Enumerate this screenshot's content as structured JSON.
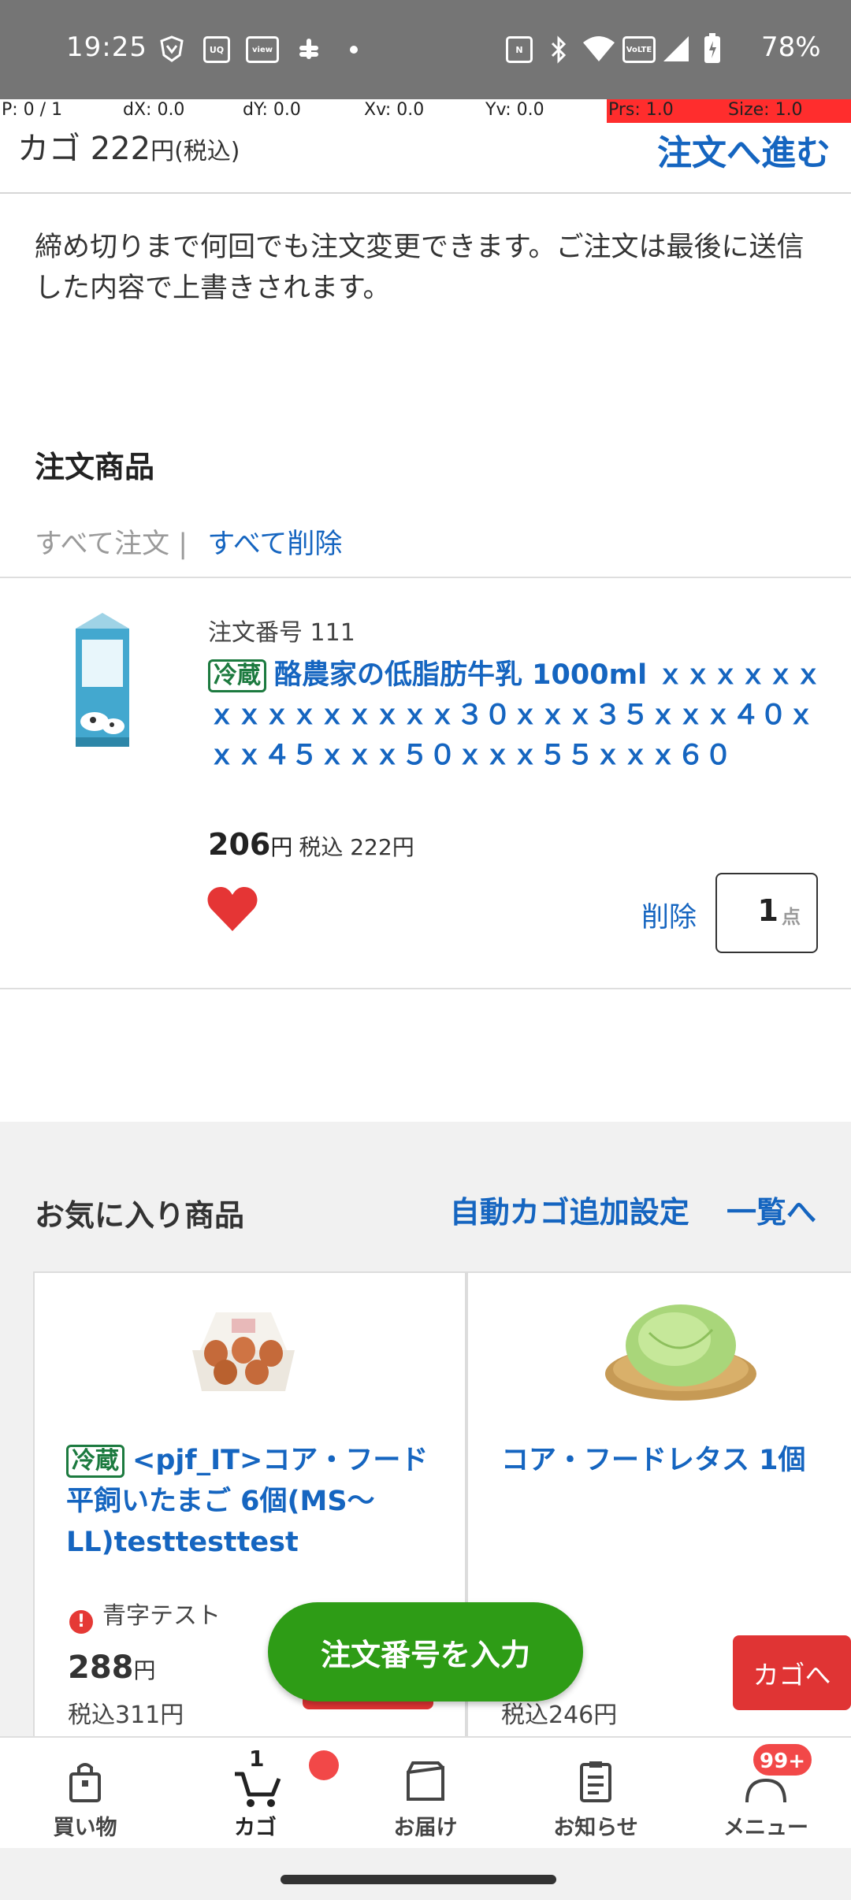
{
  "status_bar": {
    "time": "19:25",
    "battery": "78%",
    "notification_icons": [
      "shield-icon",
      "uniqlo-icon",
      "view-icon",
      "slack-icon"
    ],
    "system_icons": [
      "nfc-icon",
      "bluetooth-icon",
      "wifi-icon",
      "volte-icon",
      "signal-icon",
      "battery-icon"
    ]
  },
  "debug": {
    "p": "P: 0 / 1",
    "dx": "dX: 0.0",
    "dy": "dY: 0.0",
    "xv": "Xv: 0.0",
    "yv": "Yv: 0.0",
    "prs": "Prs: 1.0",
    "size": "Size: 1.0"
  },
  "cart_header": {
    "label": "カゴ",
    "amount": "222",
    "unit": "円",
    "tax_note": "(税込)",
    "checkout": "注文へ進む"
  },
  "notice": "締め切りまで何回でも注文変更できます。ご注文は最後に送信した内容で上書きされます。",
  "order_section": {
    "title": "注文商品",
    "order_all": "すべて注文",
    "separator": "|",
    "delete_all": "すべて削除"
  },
  "order_item": {
    "order_number": "注文番号 111",
    "tag": "冷蔵",
    "name": "酪農家の低脂肪牛乳 1000ml ｘｘｘｘｘｘｘｘｘｘｘｘｘｘｘ３０ｘｘｘ３５ｘｘｘ４０ｘｘｘ４５ｘｘｘ５０ｘｘｘ５５ｘｘｘ６０",
    "price": "206",
    "price_unit": "円",
    "tax_price": "税込 222円",
    "delete": "削除",
    "quantity": "1",
    "quantity_unit": "点"
  },
  "favorites": {
    "title": "お気に入り商品",
    "auto_cart": "自動カゴ追加設定",
    "view_all": "一覧へ",
    "items": [
      {
        "tag": "冷蔵",
        "name": "<pjf_IT>コア・フード平飼いたまご 6個(MS〜LL)testtesttest",
        "warning": "青字テスト",
        "price": "288",
        "price_unit": "円",
        "tax_price": "税込311円"
      },
      {
        "name": "コア・フードレタス 1個",
        "tax_price": "税込246円",
        "cart_button": "カゴへ"
      }
    ]
  },
  "fab": "注文番号を入力",
  "bottom_nav": {
    "items": [
      {
        "label": "買い物",
        "icon": "shopping-bag-icon"
      },
      {
        "label": "カゴ",
        "icon": "cart-icon",
        "count": "1"
      },
      {
        "label": "お届け",
        "icon": "delivery-box-icon"
      },
      {
        "label": "お知らせ",
        "icon": "clipboard-icon"
      },
      {
        "label": "メニュー",
        "icon": "person-icon",
        "badge": "99+"
      }
    ]
  },
  "colors": {
    "link_blue": "#1565c0",
    "chilled_green": "#1c7a3f",
    "action_red": "#e03434",
    "fab_green": "#2e9c16",
    "status_gray": "#757575"
  }
}
